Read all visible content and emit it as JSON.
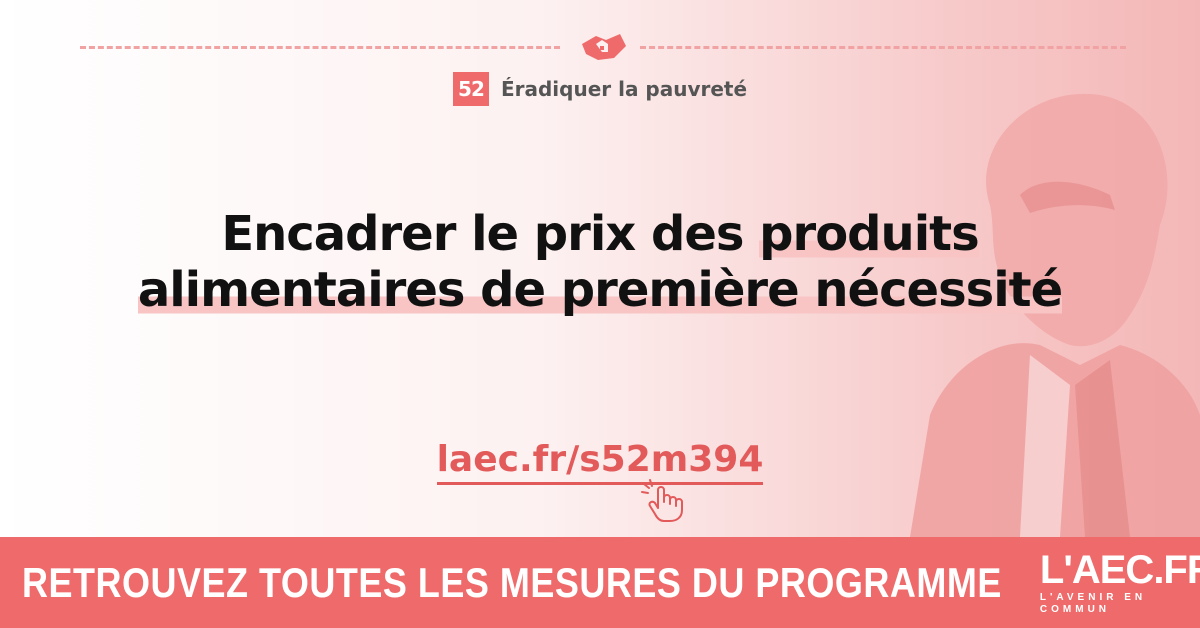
{
  "category": {
    "number": "52",
    "label": "Éradiquer la pauvreté",
    "icon": "handshake-icon"
  },
  "headline": {
    "line1_plain": "Encadrer le prix des ",
    "line1_highlight": "produits",
    "line2_highlight": "alimentaires de première nécessité"
  },
  "link": {
    "text": "laec.fr/s52m394",
    "icon": "hand-pointer-click-icon"
  },
  "banner": {
    "cta_text": "RETROUVEZ TOUTES LES MESURES DU PROGRAMME",
    "logo_main": "L'AEC.FR",
    "logo_sub": "L'AVENIR EN COMMUN"
  },
  "colors": {
    "accent": "#ef6b6b",
    "highlight": "#f8c4c4",
    "link": "#e25a5a"
  }
}
